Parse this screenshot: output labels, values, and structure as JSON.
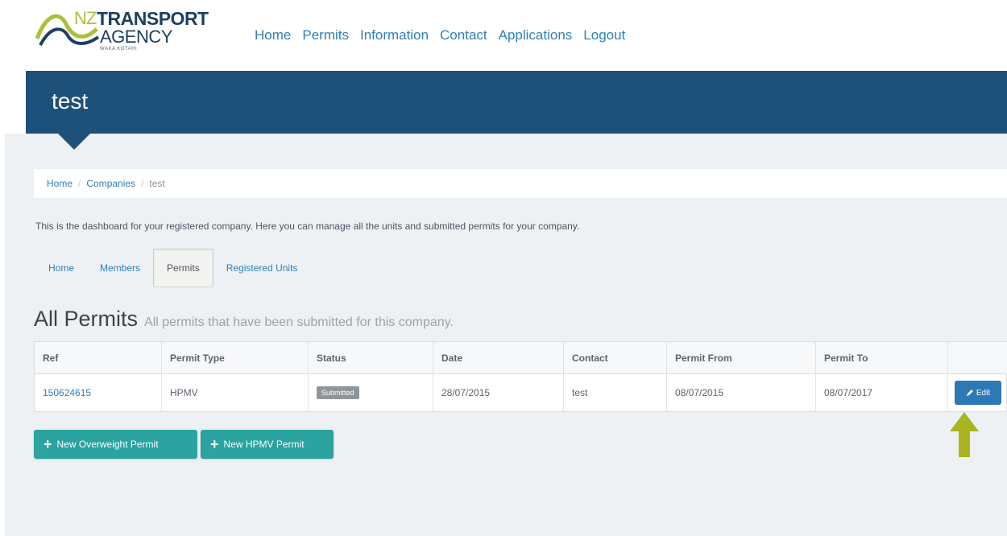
{
  "header": {
    "logo": {
      "nz": "NZ",
      "line1": "TRANSPORT",
      "line2": "AGENCY",
      "line3": "WAKA KOTAHI"
    },
    "nav": [
      "Home",
      "Permits",
      "Information",
      "Contact",
      "Applications",
      "Logout"
    ]
  },
  "page_title": "test",
  "breadcrumb": {
    "items": [
      "Home",
      "Companies"
    ],
    "current": "test",
    "separator": "/"
  },
  "intro": "This is the dashboard for your registered company. Here you can manage all the units and submitted permits for your company.",
  "tabs": [
    {
      "label": "Home",
      "active": false
    },
    {
      "label": "Members",
      "active": false
    },
    {
      "label": "Permits",
      "active": true
    },
    {
      "label": "Registered Units",
      "active": false
    }
  ],
  "section": {
    "title": "All Permits",
    "subtitle": "All permits that have been submitted for this company."
  },
  "table": {
    "columns": [
      "Ref",
      "Permit Type",
      "Status",
      "Date",
      "Contact",
      "Permit From",
      "Permit To",
      ""
    ],
    "rows": [
      {
        "ref": "150624615",
        "type": "HPMV",
        "status": "Submitted",
        "date": "28/07/2015",
        "contact": "test",
        "from": "08/07/2015",
        "to": "08/07/2017",
        "action": "Edit"
      }
    ]
  },
  "buttons": {
    "new_overweight": "New Overweight Permit",
    "new_hpmv": "New HPMV Permit"
  },
  "colors": {
    "brand_navy": "#1d5179",
    "link": "#2f7fb8",
    "teal_button": "#2aa3a1",
    "edit_button": "#2c79b5",
    "arrow_green": "#a8b520"
  },
  "icons": {
    "edit": "pencil-icon",
    "add": "plus-icon",
    "callout": "up-arrow-icon"
  }
}
